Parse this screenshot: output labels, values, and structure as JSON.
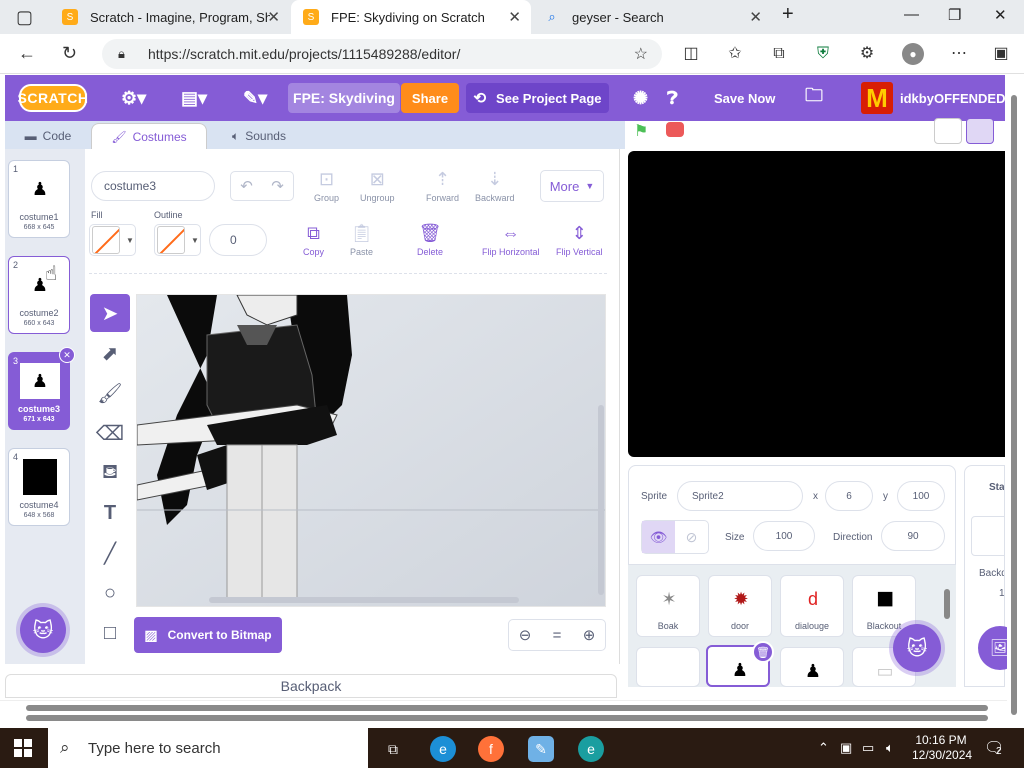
{
  "browser": {
    "tabs": [
      {
        "title": "Scratch - Imagine, Program, Share"
      },
      {
        "title": "FPE: Skydiving on Scratch"
      },
      {
        "title": "geyser - Search"
      }
    ],
    "url": "https://scratch.mit.edu/projects/1115489288/editor/"
  },
  "menubar": {
    "logo": "SCRATCH",
    "project_title": "FPE: Skydiving",
    "share": "Share",
    "see_project_page": "See Project Page",
    "save_now": "Save Now",
    "username": "idkbyOFFENDED"
  },
  "editor_tabs": {
    "code": "Code",
    "costumes": "Costumes",
    "sounds": "Sounds"
  },
  "costumes": [
    {
      "num": "1",
      "name": "costume1",
      "size": "668 x 645"
    },
    {
      "num": "2",
      "name": "costume2",
      "size": "660 x 643"
    },
    {
      "num": "3",
      "name": "costume3",
      "size": "671 x 643"
    },
    {
      "num": "4",
      "name": "costume4",
      "size": "648 x 568"
    }
  ],
  "paint": {
    "costume_name": "costume3",
    "group": "Group",
    "ungroup": "Ungroup",
    "forward": "Forward",
    "backward": "Backward",
    "more": "More",
    "fill_label": "Fill",
    "outline_label": "Outline",
    "outline_width": "0",
    "copy": "Copy",
    "paste": "Paste",
    "delete": "Delete",
    "flip_h": "Flip Horizontal",
    "flip_v": "Flip Vertical",
    "convert": "Convert to Bitmap",
    "zoom_out": "−",
    "zoom_reset": "=",
    "zoom_in": "+"
  },
  "backpack": "Backpack",
  "sprite_info": {
    "sprite_label": "Sprite",
    "sprite_name": "Sprite2",
    "x_label": "x",
    "x": "6",
    "y_label": "y",
    "y": "100",
    "size_label": "Size",
    "size": "100",
    "direction_label": "Direction",
    "direction": "90"
  },
  "sprites": [
    {
      "name": "Boak",
      "glyph": "✶",
      "color": "#8a8a8a"
    },
    {
      "name": "door",
      "glyph": "✹",
      "color": "#b01818"
    },
    {
      "name": "dialouge",
      "glyph": "d",
      "color": "#e02020"
    },
    {
      "name": "Blackout",
      "glyph": "■",
      "color": "#000000"
    },
    {
      "name": "",
      "glyph": "",
      "color": "#cccccc"
    },
    {
      "name": "",
      "glyph": "♟",
      "color": "#000000"
    },
    {
      "name": "",
      "glyph": "♟",
      "color": "#000000"
    },
    {
      "name": "",
      "glyph": "▭",
      "color": "#cccccc"
    }
  ],
  "stage_pane": {
    "title": "Stage",
    "backdrops_label": "Backdrops",
    "count": "1"
  },
  "taskbar": {
    "search_placeholder": "Type here to search",
    "time": "10:16 PM",
    "date": "12/30/2024",
    "notif_count": "2"
  },
  "colors": {
    "scratch_purple": "#855cd6",
    "share_orange": "#ff8c1a"
  }
}
